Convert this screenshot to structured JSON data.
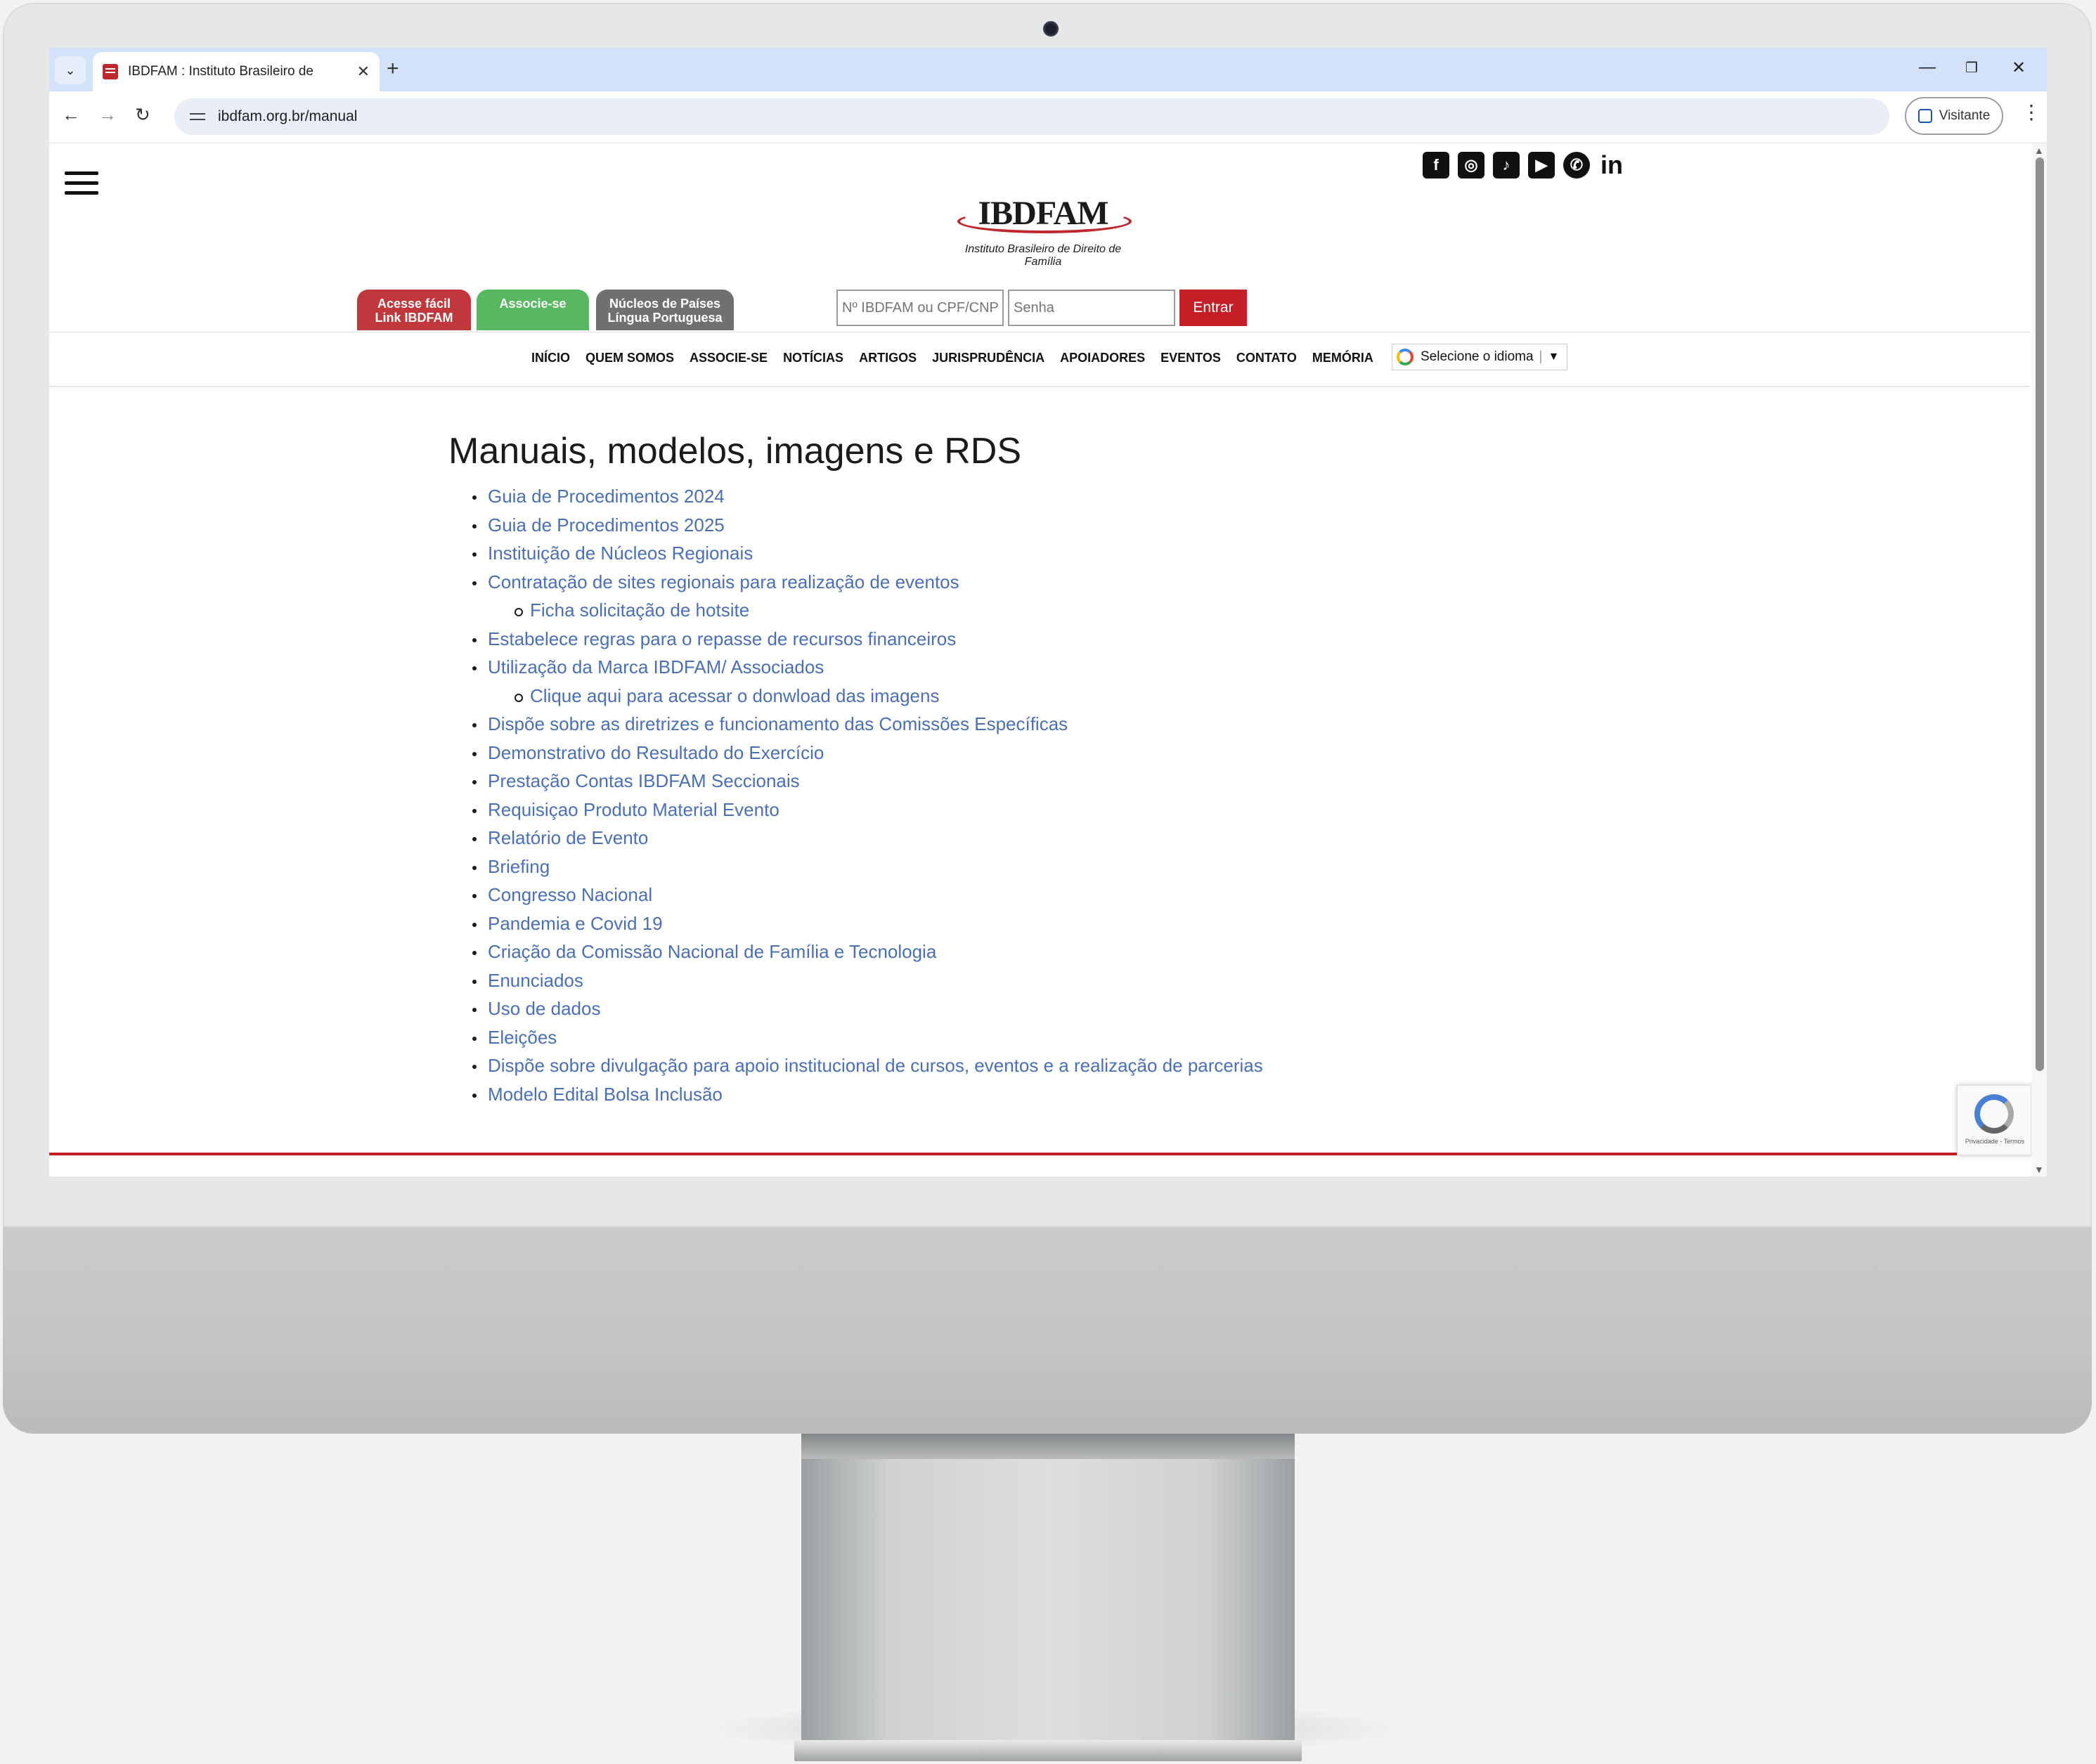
{
  "browser": {
    "tab_title": "IBDFAM : Instituto Brasileiro de",
    "url": "ibdfam.org.br/manual",
    "profile_label": "Visitante"
  },
  "header": {
    "logo_text": "IBDFAM",
    "logo_subtitle": "Instituto Brasileiro de Direito de Família",
    "social": [
      {
        "icon": "facebook-icon",
        "glyph": "f"
      },
      {
        "icon": "instagram-icon",
        "glyph": "◎"
      },
      {
        "icon": "tiktok-icon",
        "glyph": "♪"
      },
      {
        "icon": "youtube-icon",
        "glyph": "▶"
      },
      {
        "icon": "whatsapp-icon",
        "glyph": "✆"
      },
      {
        "icon": "linkedin-icon",
        "glyph": "in"
      }
    ],
    "pills": {
      "acesse_line1": "Acesse fácil",
      "acesse_line2": "Link IBDFAM",
      "associe": "Associe-se",
      "nucleos_line1": "Núcleos de Países",
      "nucleos_line2": "Língua Portuguesa"
    },
    "login": {
      "user_placeholder": "Nº IBDFAM ou CPF/CNPJ",
      "password_placeholder": "Senha",
      "submit": "Entrar"
    }
  },
  "nav": {
    "items": [
      "INÍCIO",
      "QUEM SOMOS",
      "ASSOCIE-SE",
      "NOTÍCIAS",
      "ARTIGOS",
      "JURISPRUDÊNCIA",
      "APOIADORES",
      "EVENTOS",
      "CONTATO",
      "MEMÓRIA"
    ],
    "language_label": "Selecione o idioma",
    "language_arrow": "▼"
  },
  "main": {
    "title": "Manuais, modelos, imagens e RDS",
    "links": [
      {
        "label": "Guia de Procedimentos 2024",
        "level": 1
      },
      {
        "label": "Guia de Procedimentos 2025",
        "level": 1
      },
      {
        "label": "Instituição de Núcleos Regionais",
        "level": 1
      },
      {
        "label": "Contratação de sites regionais para realização de eventos",
        "level": 1
      },
      {
        "label": "Ficha solicitação de hotsite",
        "level": 2
      },
      {
        "label": "Estabelece regras para o repasse de recursos financeiros",
        "level": 1
      },
      {
        "label": "Utilização da Marca IBDFAM/ Associados",
        "level": 1
      },
      {
        "label": "Clique aqui para acessar o donwload das imagens",
        "level": 2
      },
      {
        "label": "Dispõe sobre as diretrizes e funcionamento das Comissões Específicas",
        "level": 1
      },
      {
        "label": "Demonstrativo do Resultado do Exercício",
        "level": 1
      },
      {
        "label": "Prestação Contas IBDFAM Seccionais",
        "level": 1
      },
      {
        "label": "Requisiçao Produto Material Evento",
        "level": 1
      },
      {
        "label": "Relatório de Evento",
        "level": 1
      },
      {
        "label": "Briefing",
        "level": 1
      },
      {
        "label": "Congresso Nacional",
        "level": 1
      },
      {
        "label": "Pandemia e Covid 19",
        "level": 1
      },
      {
        "label": "Criação da Comissão Nacional de Família e Tecnologia",
        "level": 1
      },
      {
        "label": "Enunciados",
        "level": 1
      },
      {
        "label": "Uso de dados",
        "level": 1
      },
      {
        "label": "Eleições",
        "level": 1
      },
      {
        "label": "Dispõe sobre divulgação para apoio institucional de cursos, eventos e a realização de parcerias",
        "level": 1
      },
      {
        "label": "Modelo Edital Bolsa Inclusão",
        "level": 1
      }
    ]
  },
  "recaptcha": {
    "text": "Privacidade - Termos"
  },
  "colors": {
    "link": "#4a6fb5",
    "brand_red": "#c41f26",
    "green": "#58b85f"
  }
}
